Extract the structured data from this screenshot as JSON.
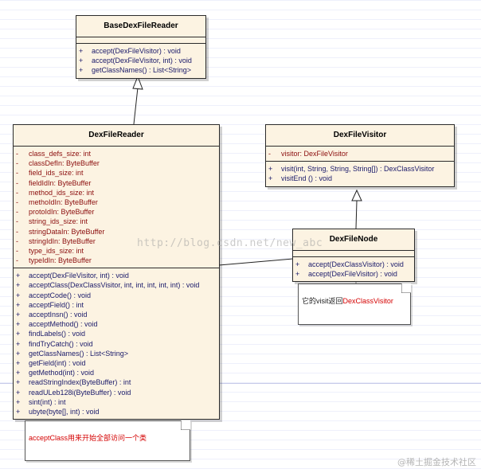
{
  "classes": {
    "base": {
      "name": "BaseDexFileReader",
      "operations": [
        {
          "vis": "+",
          "text": "accept(DexFileVisitor) : void"
        },
        {
          "vis": "+",
          "text": "accept(DexFileVisitor, int) : void"
        },
        {
          "vis": "+",
          "text": "getClassNames() : List<String>"
        }
      ]
    },
    "reader": {
      "name": "DexFileReader",
      "attributes": [
        {
          "vis": "-",
          "text": "class_defs_size:  int"
        },
        {
          "vis": "-",
          "text": "classDefIn:  ByteBuffer"
        },
        {
          "vis": "-",
          "text": "field_ids_size:  int"
        },
        {
          "vis": "-",
          "text": "fieldIdIn:  ByteBuffer"
        },
        {
          "vis": "-",
          "text": "method_ids_size:  int"
        },
        {
          "vis": "-",
          "text": "methoIdIn:  ByteBuffer"
        },
        {
          "vis": "-",
          "text": "protoIdIn:  ByteBuffer"
        },
        {
          "vis": "-",
          "text": "string_ids_size:  int"
        },
        {
          "vis": "-",
          "text": "stringDataIn:  ByteBuffer"
        },
        {
          "vis": "-",
          "text": "stringIdIn:  ByteBuffer"
        },
        {
          "vis": "-",
          "text": "type_ids_size:  int"
        },
        {
          "vis": "-",
          "text": "typeIdIn:  ByteBuffer"
        }
      ],
      "operations": [
        {
          "vis": "+",
          "text": "accept(DexFileVisitor, int) : void"
        },
        {
          "vis": "+",
          "text": "acceptClass(DexClassVisitor, int, int, int, int, int) : void"
        },
        {
          "vis": "+",
          "text": "acceptCode() : void"
        },
        {
          "vis": "+",
          "text": "acceptField() : int"
        },
        {
          "vis": "+",
          "text": "acceptInsn() : void"
        },
        {
          "vis": "+",
          "text": "acceptMethod() : void"
        },
        {
          "vis": "+",
          "text": "findLabels() : void"
        },
        {
          "vis": "+",
          "text": "findTryCatch() : void"
        },
        {
          "vis": "+",
          "text": "getClassNames() :  List<String>"
        },
        {
          "vis": "+",
          "text": "getField(int) : void"
        },
        {
          "vis": "+",
          "text": "getMethod(int) : void"
        },
        {
          "vis": "+",
          "text": "readStringIndex(ByteBuffer) : int"
        },
        {
          "vis": "+",
          "text": "readULeb128i(ByteBuffer) : void"
        },
        {
          "vis": "+",
          "text": "sint(int) : int"
        },
        {
          "vis": "+",
          "text": "ubyte(byte[], int) : void"
        }
      ]
    },
    "visitor": {
      "name": "DexFileVisitor",
      "attributes": [
        {
          "vis": "-",
          "text": "visitor:  DexFileVisitor"
        }
      ],
      "operations": [
        {
          "vis": "+",
          "text": "visit(int, String, String, String[]) : DexClassVisitor"
        },
        {
          "vis": "+",
          "text": "visitEnd () : void"
        }
      ]
    },
    "node": {
      "name": "DexFileNode",
      "operations": [
        {
          "vis": "+",
          "text": "accept(DexClassVisitor) : void"
        },
        {
          "vis": "+",
          "text": "accept(DexFileVisitor) : void"
        }
      ]
    }
  },
  "notes": {
    "visitor_note": {
      "prefix": "它的visit返回",
      "highlight": "DexClassVisitor"
    },
    "accept_note": {
      "text": "acceptClass用来开始全部访问一个类"
    }
  },
  "watermark": "http://blog.csdn.net/new_abc",
  "brand": "@稀土掘金技术社区",
  "colors": {
    "class_fill": "#fcf3e2",
    "attribute_text": "#8b0d0d",
    "operation_text": "#1a1a6a",
    "note_highlight": "#d40000"
  }
}
